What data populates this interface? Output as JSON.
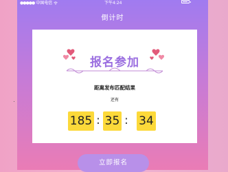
{
  "status_bar": {
    "carrier": "中国电信",
    "signal_dots": "●●●●●",
    "time": "下午4:24"
  },
  "nav": {
    "title": "倒计时"
  },
  "card": {
    "banner_title": "报名参加",
    "subtitle": "距离发布匹配结果",
    "remain_label": "还有",
    "countdown": {
      "hours": "185",
      "minutes": "35",
      "seconds": "34",
      "separator": ":"
    }
  },
  "actions": {
    "register_label": "立即报名"
  },
  "colors": {
    "accent": "#9b6fe0",
    "digit_bg": "#fcd93a",
    "button": "#b890e9"
  }
}
